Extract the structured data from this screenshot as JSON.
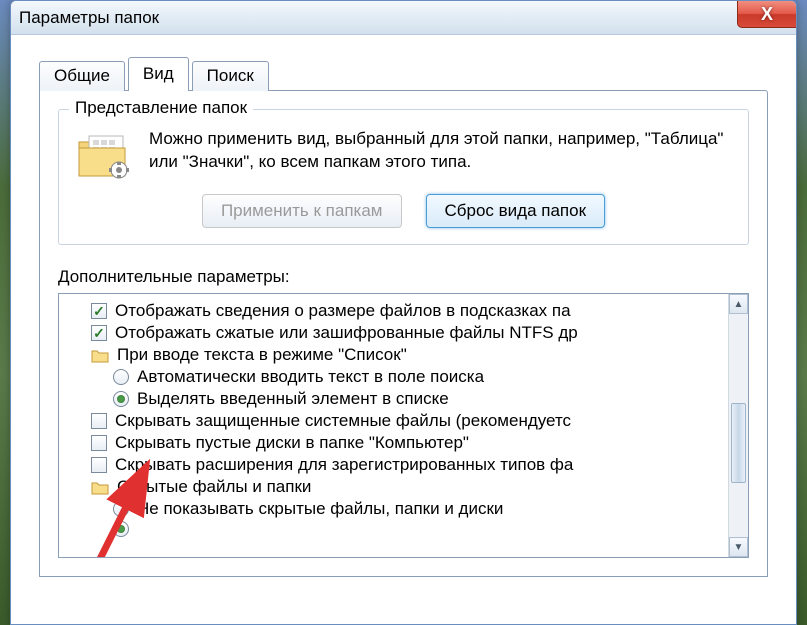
{
  "window": {
    "title": "Параметры папок",
    "close": "X"
  },
  "tabs": [
    {
      "label": "Общие"
    },
    {
      "label": "Вид"
    },
    {
      "label": "Поиск"
    }
  ],
  "fieldset": {
    "legend": "Представление папок",
    "desc": "Можно применить вид, выбранный для этой папки, например, \"Таблица\" или \"Значки\", ко всем папкам этого типа.",
    "apply_btn": "Применить к папкам",
    "reset_btn": "Сброс вида папок"
  },
  "advanced": {
    "label": "Дополнительные параметры:",
    "items": [
      {
        "type": "check",
        "checked": true,
        "text": "Отображать сведения о размере файлов в подсказках па"
      },
      {
        "type": "check",
        "checked": true,
        "text": "Отображать сжатые или зашифрованные файлы NTFS др"
      },
      {
        "type": "folder",
        "text": "При вводе текста в режиме \"Список\""
      },
      {
        "type": "radio",
        "checked": false,
        "indent": 1,
        "text": "Автоматически вводить текст в поле поиска"
      },
      {
        "type": "radio",
        "checked": true,
        "indent": 1,
        "text": "Выделять введенный элемент в списке"
      },
      {
        "type": "check",
        "checked": false,
        "text": "Скрывать защищенные системные файлы (рекомендуетс"
      },
      {
        "type": "check",
        "checked": false,
        "text": "Скрывать пустые диски в папке \"Компьютер\""
      },
      {
        "type": "check",
        "checked": false,
        "text": "Скрывать расширения для зарегистрированных типов фа"
      },
      {
        "type": "folder",
        "text": "Скрытые файлы и папки"
      },
      {
        "type": "radio",
        "checked": false,
        "indent": 1,
        "text": "Не показывать скрытые файлы, папки и диски"
      },
      {
        "type": "radio",
        "checked": true,
        "indent": 1,
        "highlight": true,
        "text": " "
      }
    ]
  }
}
